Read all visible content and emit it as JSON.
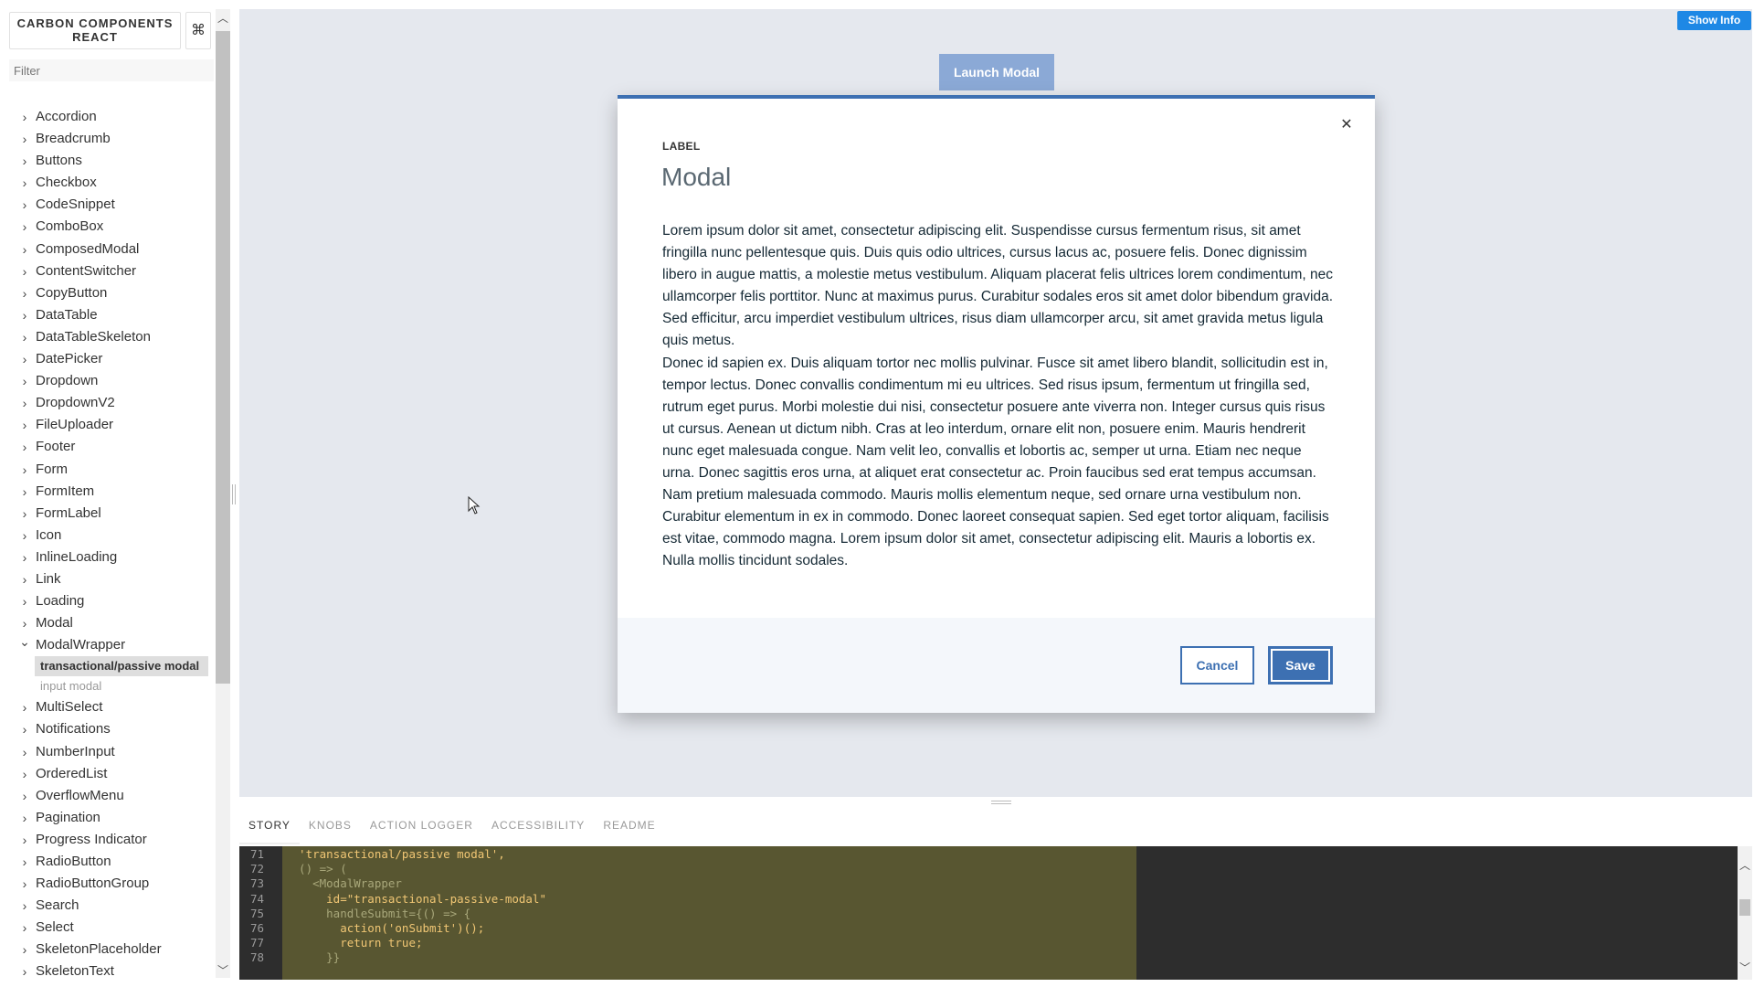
{
  "sidebar": {
    "brand": "CARBON COMPONENTS REACT",
    "shortcut_icon": "command-icon",
    "filter_placeholder": "Filter",
    "items": [
      {
        "label": "Accordion",
        "icon": "chevron-right-icon"
      },
      {
        "label": "Breadcrumb",
        "icon": "chevron-right-icon"
      },
      {
        "label": "Buttons",
        "icon": "chevron-right-icon"
      },
      {
        "label": "Checkbox",
        "icon": "chevron-right-icon"
      },
      {
        "label": "CodeSnippet",
        "icon": "chevron-right-icon"
      },
      {
        "label": "ComboBox",
        "icon": "chevron-right-icon"
      },
      {
        "label": "ComposedModal",
        "icon": "chevron-right-icon"
      },
      {
        "label": "ContentSwitcher",
        "icon": "chevron-right-icon"
      },
      {
        "label": "CopyButton",
        "icon": "chevron-right-icon"
      },
      {
        "label": "DataTable",
        "icon": "chevron-right-icon"
      },
      {
        "label": "DataTableSkeleton",
        "icon": "chevron-right-icon"
      },
      {
        "label": "DatePicker",
        "icon": "chevron-right-icon"
      },
      {
        "label": "Dropdown",
        "icon": "chevron-right-icon"
      },
      {
        "label": "DropdownV2",
        "icon": "chevron-right-icon"
      },
      {
        "label": "FileUploader",
        "icon": "chevron-right-icon"
      },
      {
        "label": "Footer",
        "icon": "chevron-right-icon"
      },
      {
        "label": "Form",
        "icon": "chevron-right-icon"
      },
      {
        "label": "FormItem",
        "icon": "chevron-right-icon"
      },
      {
        "label": "FormLabel",
        "icon": "chevron-right-icon"
      },
      {
        "label": "Icon",
        "icon": "chevron-right-icon"
      },
      {
        "label": "InlineLoading",
        "icon": "chevron-right-icon"
      },
      {
        "label": "Link",
        "icon": "chevron-right-icon"
      },
      {
        "label": "Loading",
        "icon": "chevron-right-icon"
      },
      {
        "label": "Modal",
        "icon": "chevron-right-icon"
      },
      {
        "label": "ModalWrapper",
        "icon": "chevron-down-icon",
        "expanded": true,
        "children": [
          {
            "label": "transactional/passive modal",
            "selected": true
          },
          {
            "label": "input modal",
            "selected": false
          }
        ]
      },
      {
        "label": "MultiSelect",
        "icon": "chevron-right-icon"
      },
      {
        "label": "Notifications",
        "icon": "chevron-right-icon"
      },
      {
        "label": "NumberInput",
        "icon": "chevron-right-icon"
      },
      {
        "label": "OrderedList",
        "icon": "chevron-right-icon"
      },
      {
        "label": "OverflowMenu",
        "icon": "chevron-right-icon"
      },
      {
        "label": "Pagination",
        "icon": "chevron-right-icon"
      },
      {
        "label": "Progress Indicator",
        "icon": "chevron-right-icon"
      },
      {
        "label": "RadioButton",
        "icon": "chevron-right-icon"
      },
      {
        "label": "RadioButtonGroup",
        "icon": "chevron-right-icon"
      },
      {
        "label": "Search",
        "icon": "chevron-right-icon"
      },
      {
        "label": "Select",
        "icon": "chevron-right-icon"
      },
      {
        "label": "SkeletonPlaceholder",
        "icon": "chevron-right-icon"
      },
      {
        "label": "SkeletonText",
        "icon": "chevron-right-icon"
      }
    ]
  },
  "preview": {
    "show_info_label": "Show Info",
    "launch_label": "Launch Modal",
    "modal": {
      "label": "LABEL",
      "heading": "Modal",
      "close_icon": "close-icon",
      "paragraph_1": "Lorem ipsum dolor sit amet, consectetur adipiscing elit. Suspendisse cursus fermentum risus, sit amet fringilla nunc pellentesque quis. Duis quis odio ultrices, cursus lacus ac, posuere felis. Donec dignissim libero in augue mattis, a molestie metus vestibulum. Aliquam placerat felis ultrices lorem condimentum, nec ullamcorper felis porttitor. Nunc at maximus purus. Curabitur sodales eros sit amet dolor bibendum gravida. Sed efficitur, arcu imperdiet vestibulum ultrices, risus diam ullamcorper arcu, sit amet gravida metus ligula quis metus.",
      "paragraph_2": "Donec id sapien ex. Duis aliquam tortor nec mollis pulvinar. Fusce sit amet libero blandit, sollicitudin est in, tempor lectus. Donec convallis condimentum mi eu ultrices. Sed risus ipsum, fermentum ut fringilla sed, rutrum eget purus. Morbi molestie dui nisi, consectetur posuere ante viverra non. Integer cursus quis risus ut cursus. Aenean ut dictum nibh. Cras at leo interdum, ornare elit non, posuere enim. Mauris hendrerit nunc eget malesuada congue. Nam velit leo, convallis et lobortis ac, semper ut urna. Etiam nec neque urna. Donec sagittis eros urna, at aliquet erat consectetur ac. Proin faucibus sed erat tempus accumsan. Nam pretium malesuada commodo. Mauris mollis elementum neque, sed ornare urna vestibulum non. Curabitur elementum in ex in commodo. Donec laoreet consequat sapien. Sed eget tortor aliquam, facilisis est vitae, commodo magna. Lorem ipsum dolor sit amet, consectetur adipiscing elit. Mauris a lobortis ex. Nulla mollis tincidunt sodales.",
      "cancel_label": "Cancel",
      "save_label": "Save"
    }
  },
  "addons": {
    "tabs": [
      "STORY",
      "KNOBS",
      "ACTION LOGGER",
      "ACCESSIBILITY",
      "README"
    ],
    "active_tab": "STORY",
    "code_lines": [
      {
        "num": "71",
        "text": "  'transactional/passive modal',"
      },
      {
        "num": "72",
        "text": "  () => ("
      },
      {
        "num": "73",
        "text": "    <ModalWrapper"
      },
      {
        "num": "74",
        "text": "      id=\"transactional-passive-modal\""
      },
      {
        "num": "75",
        "text": "      handleSubmit={() => {"
      },
      {
        "num": "76",
        "text": "        action('onSubmit')();"
      },
      {
        "num": "77",
        "text": "        return true;"
      },
      {
        "num": "78",
        "text": "      }}"
      }
    ]
  },
  "colors": {
    "accent": "#3d70b2",
    "launch_button": "#8ba9d6",
    "show_info": "#1e88e5",
    "code_highlight": "#585631"
  }
}
